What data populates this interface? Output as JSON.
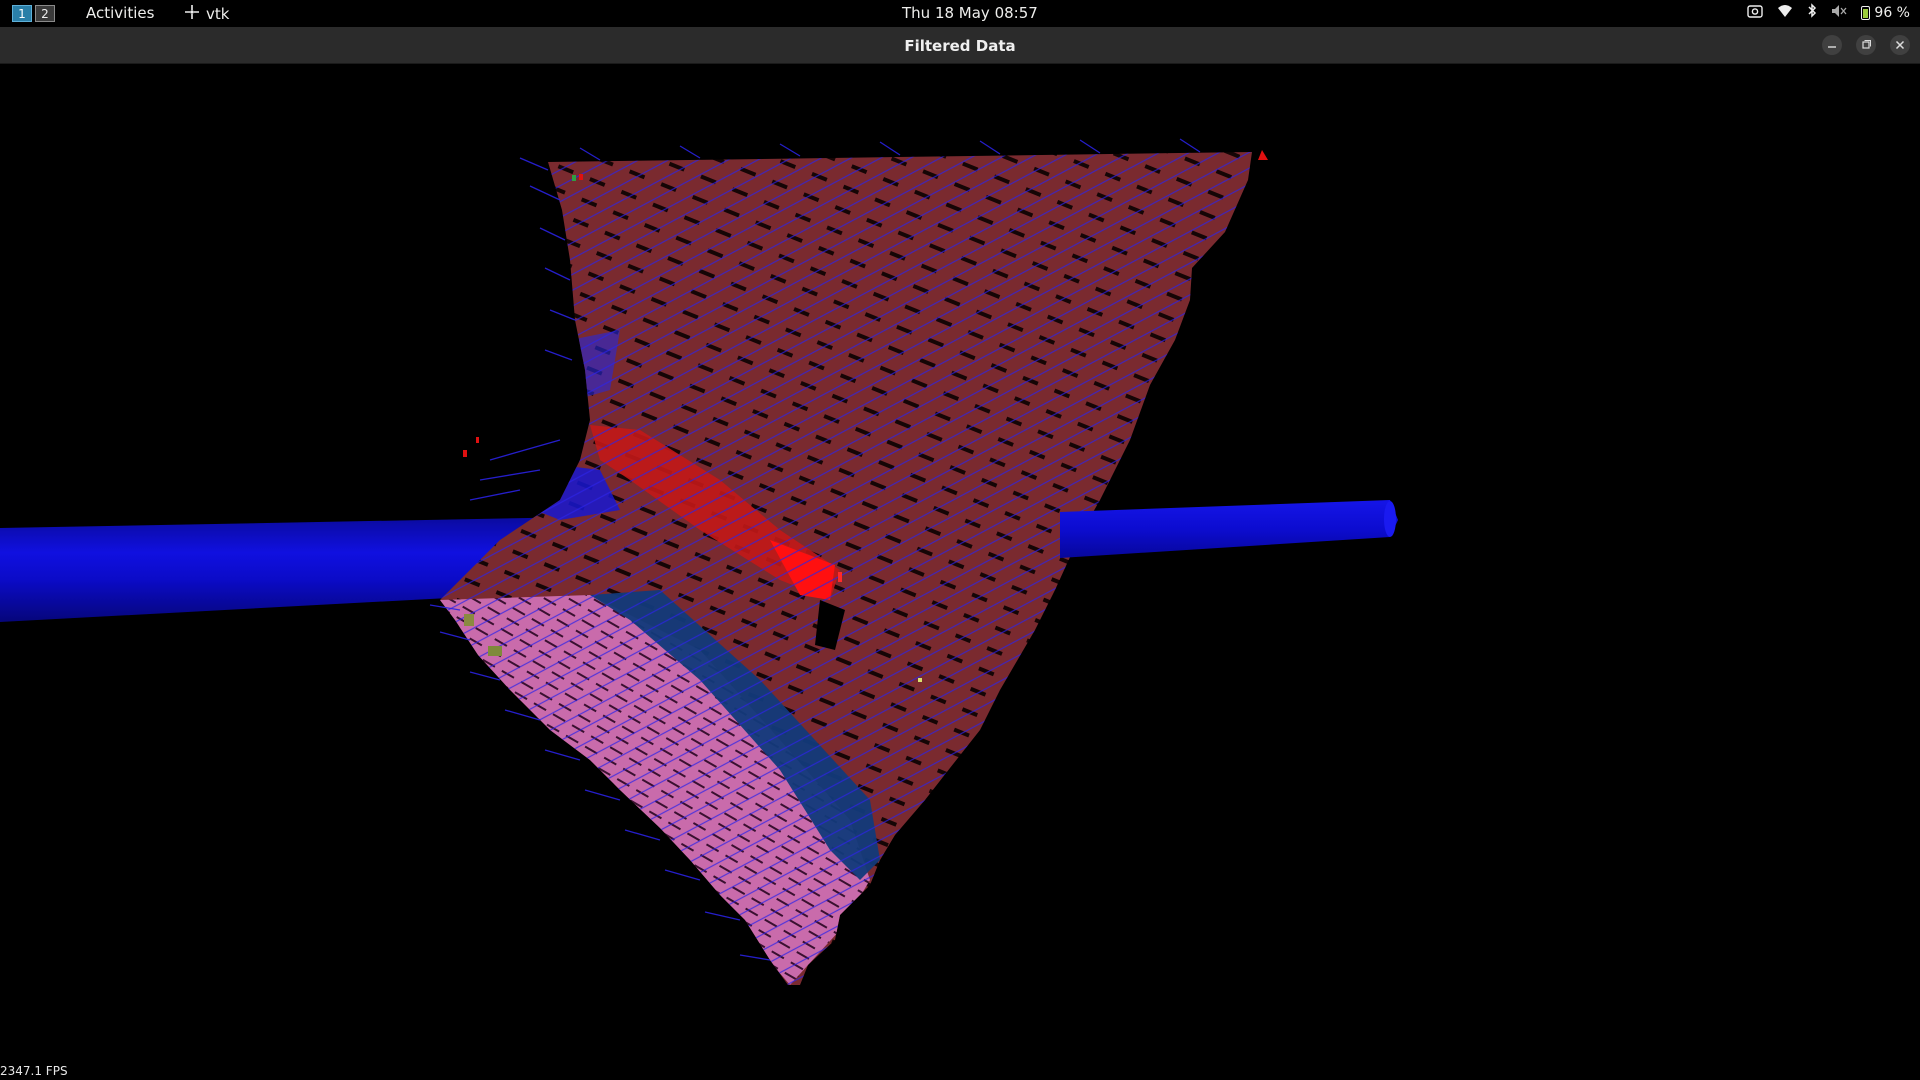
{
  "topbar": {
    "workspaces": [
      "1",
      "2"
    ],
    "activities": "Activities",
    "app_name": "vtk",
    "clock": "Thu 18 May  08:57",
    "battery": "96 %",
    "tray_icons": [
      "screenshot-icon",
      "wifi-icon",
      "bluetooth-icon",
      "volume-muted-icon",
      "battery-icon"
    ]
  },
  "window": {
    "title": "Filtered Data",
    "controls": [
      "minimize",
      "restore",
      "close"
    ]
  },
  "viewport": {
    "fps": "2347.1 FPS",
    "colors": {
      "surface_main": "#7b2a2e",
      "surface_pink": "#c76aa8",
      "surface_blue_band": "#123a7a",
      "highlight_red": "#e01010",
      "glyphs": "#2020d8",
      "cylinder": "#0a0ad0"
    }
  }
}
